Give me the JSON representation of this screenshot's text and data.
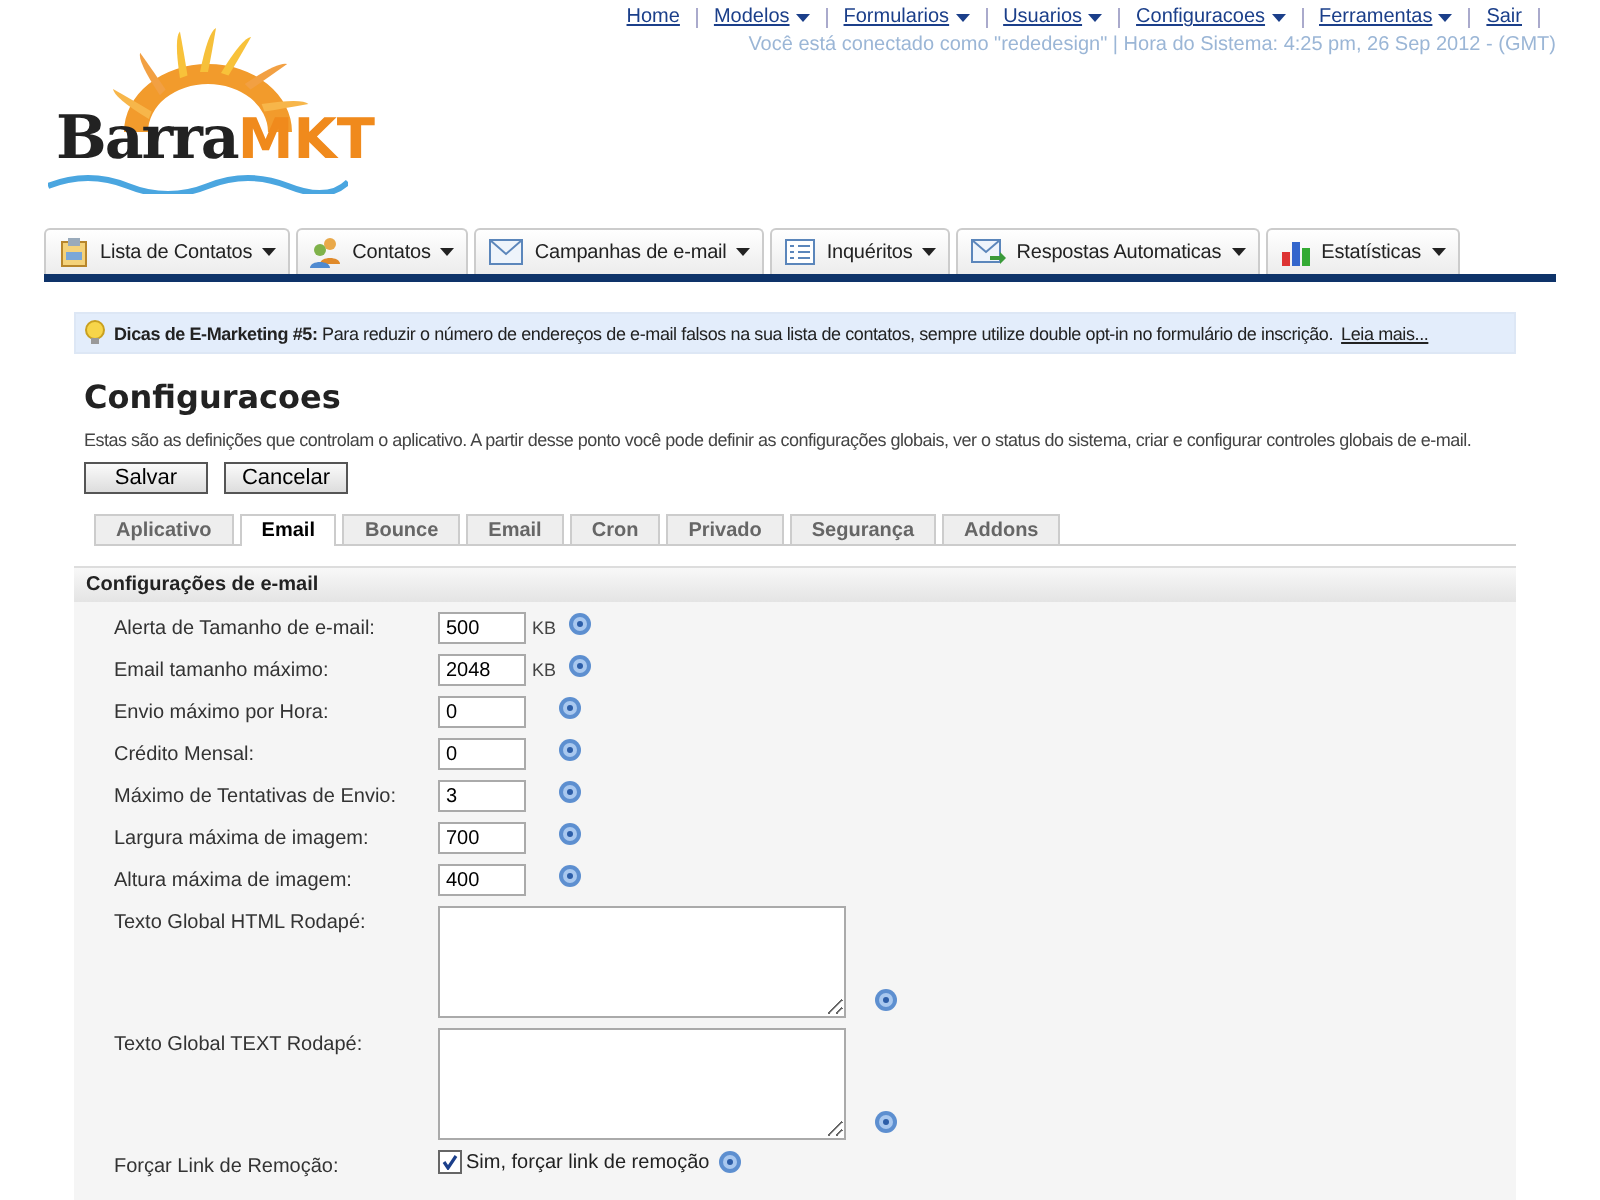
{
  "top_nav": {
    "links": [
      {
        "label": "Home",
        "dropdown": false
      },
      {
        "label": "Modelos",
        "dropdown": true
      },
      {
        "label": "Formularios",
        "dropdown": true
      },
      {
        "label": "Usuarios",
        "dropdown": true
      },
      {
        "label": "Configuracoes",
        "dropdown": true
      },
      {
        "label": "Ferramentas",
        "dropdown": true
      },
      {
        "label": "Sair",
        "dropdown": false
      }
    ],
    "status": "Você está conectado como \"rededesign\" | Hora do Sistema: 4:25 pm, 26 Sep 2012 - (GMT)"
  },
  "logo": {
    "word1": "Barra",
    "word2": "MKT"
  },
  "main_tabs": [
    {
      "label": "Lista de Contatos"
    },
    {
      "label": "Contatos"
    },
    {
      "label": "Campanhas de e-mail"
    },
    {
      "label": "Inquéritos"
    },
    {
      "label": "Respostas Automaticas"
    },
    {
      "label": "Estatísticas"
    }
  ],
  "tip": {
    "text": "**Dicas de E-Marketing #5:** Para reduzir o número de endereços de e-mail falsos na sua lista de contatos, sempre utilize double opt-in no formulário de inscrição.",
    "link": "Leia mais..."
  },
  "title": "Configuracoes",
  "description": "Estas são as definições que controlam o aplicativo. A partir desse ponto você pode definir as configurações globais, ver o status do sistema, criar e configurar controles globais de e-mail.",
  "buttons": [
    "Salvar",
    "Cancelar"
  ],
  "sub_tabs": [
    {
      "label": "Aplicativo",
      "selected": false
    },
    {
      "label": "Email",
      "selected": true
    },
    {
      "label": "Bounce",
      "selected": false
    },
    {
      "label": "Email",
      "selected": false
    },
    {
      "label": "Cron",
      "selected": false
    },
    {
      "label": "Privado",
      "selected": false
    },
    {
      "label": "Segurança",
      "selected": false
    },
    {
      "label": "Addons",
      "selected": false
    }
  ],
  "section": {
    "title": "Configurações de e-mail",
    "fields": [
      {
        "kind": "text",
        "label": "Alerta de Tamanho de e-mail:",
        "value": "500",
        "unit": "KB"
      },
      {
        "kind": "text",
        "label": "Email tamanho máximo:",
        "value": "2048",
        "unit": "KB"
      },
      {
        "kind": "text",
        "label": "Envio máximo por Hora:",
        "value": "0"
      },
      {
        "kind": "text",
        "label": "Crédito Mensal:",
        "value": "0"
      },
      {
        "kind": "text",
        "label": "Máximo de Tentativas de Envio:",
        "value": "3"
      },
      {
        "kind": "text",
        "label": "Largura máxima de imagem:",
        "value": "700"
      },
      {
        "kind": "text",
        "label": "Altura máxima de imagem:",
        "value": "400"
      },
      {
        "kind": "textarea",
        "label": "Texto Global HTML Rodapé:"
      },
      {
        "kind": "textarea",
        "label": "Texto Global TEXT Rodapé:"
      },
      {
        "kind": "checkbox",
        "label": "Forçar Link de Remoção:",
        "option": "Sim, forçar link de remoção",
        "checked": true
      }
    ]
  }
}
